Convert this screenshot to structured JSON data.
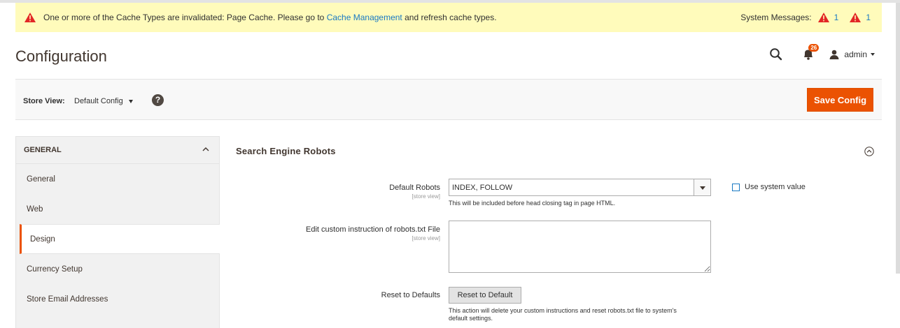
{
  "message_bar": {
    "text_before": "One or more of the Cache Types are invalidated: Page Cache. Please go to",
    "link": "Cache Management",
    "text_after": "and refresh cache types.",
    "system_messages_label": "System Messages:",
    "count_1": "1",
    "count_2": "1",
    "icon": "warning-icon",
    "warning_color": "#e22626"
  },
  "header": {
    "title": "Configuration",
    "notifications_count": "26",
    "user": "admin"
  },
  "store_bar": {
    "label": "Store View:",
    "selected": "Default Config",
    "help": "?",
    "save_label": "Save Config"
  },
  "sidebar": {
    "section": "GENERAL",
    "items": [
      {
        "label": "General"
      },
      {
        "label": "Web"
      },
      {
        "label": "Design"
      },
      {
        "label": "Currency Setup"
      },
      {
        "label": "Store Email Addresses"
      }
    ],
    "active_index": 2
  },
  "main": {
    "section_title": "Search Engine Robots",
    "default_robots": {
      "label": "Default Robots",
      "scope": "[store view]",
      "value": "INDEX, FOLLOW",
      "note": "This will be included before head closing tag in page HTML.",
      "use_system_value": "Use system value"
    },
    "custom_instruction": {
      "label": "Edit custom instruction of robots.txt File",
      "scope": "[store view]",
      "value": ""
    },
    "reset": {
      "label": "Reset to Defaults",
      "button": "Reset to Default",
      "note_line1": "This action will delete your custom instructions and reset robots.txt file to system's",
      "note_line2": "default settings."
    }
  },
  "colors": {
    "accent": "#eb5202",
    "link": "#1979c3",
    "message_bg": "#fffbbb"
  }
}
